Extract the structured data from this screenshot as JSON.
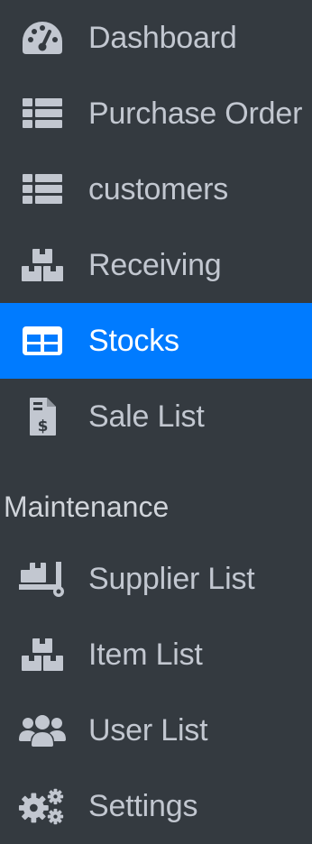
{
  "sidebar": {
    "items": [
      {
        "label": "Dashboard",
        "icon": "tachometer-icon",
        "active": false
      },
      {
        "label": "Purchase Order",
        "icon": "table-list-icon",
        "active": false
      },
      {
        "label": "customers",
        "icon": "table-list-icon",
        "active": false
      },
      {
        "label": "Receiving",
        "icon": "boxes-icon",
        "active": false
      },
      {
        "label": "Stocks",
        "icon": "table-icon",
        "active": true
      },
      {
        "label": "Sale List",
        "icon": "invoice-dollar-icon",
        "active": false
      }
    ],
    "maintenance_header": "Maintenance",
    "maintenance_items": [
      {
        "label": "Supplier List",
        "icon": "dolly-icon"
      },
      {
        "label": "Item List",
        "icon": "boxes-icon"
      },
      {
        "label": "User List",
        "icon": "users-icon"
      },
      {
        "label": "Settings",
        "icon": "cogs-icon"
      }
    ]
  },
  "colors": {
    "sidebar_background": "#343a40",
    "text": "#c2c7d0",
    "active_background": "#007bff",
    "active_text": "#ffffff"
  }
}
